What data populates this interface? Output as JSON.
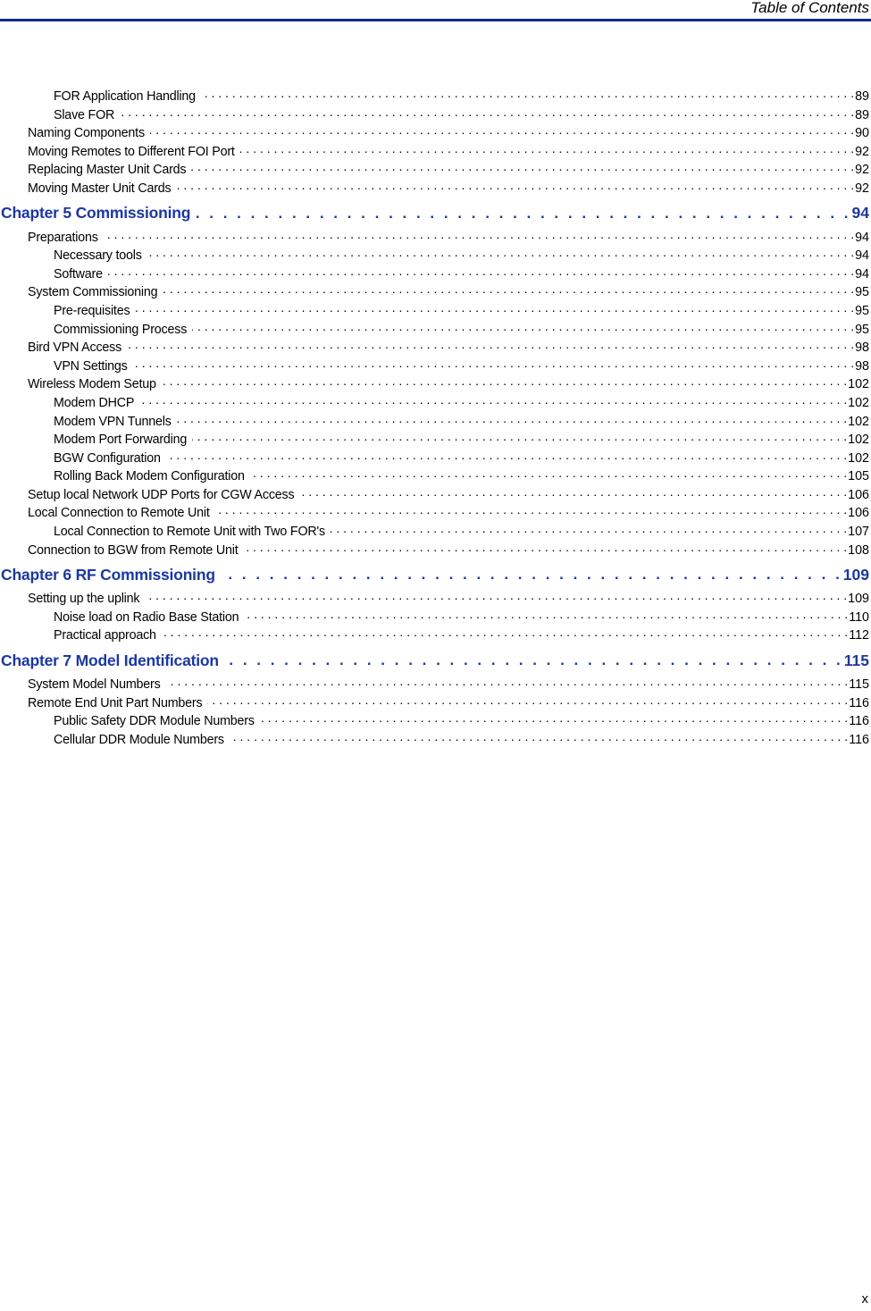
{
  "header": {
    "title": "Table of Contents",
    "rule_color": "#0a2a8f"
  },
  "toc": {
    "entries": [
      {
        "level": 2,
        "label": "FOR Application Handling",
        "page": "89"
      },
      {
        "level": 2,
        "label": "Slave FOR",
        "page": "89"
      },
      {
        "level": 1,
        "label": "Naming Components",
        "page": "90"
      },
      {
        "level": 1,
        "label": "Moving Remotes to Different FOI Port",
        "page": "92"
      },
      {
        "level": 1,
        "label": "Replacing Master Unit Cards",
        "page": "92"
      },
      {
        "level": 1,
        "label": "Moving Master Unit Cards",
        "page": "92"
      },
      {
        "level": 0,
        "label": "Chapter 5  Commissioning",
        "page": "94"
      },
      {
        "level": 1,
        "label": "Preparations",
        "page": "94"
      },
      {
        "level": 2,
        "label": "Necessary tools",
        "page": "94"
      },
      {
        "level": 2,
        "label": "Software",
        "page": "94"
      },
      {
        "level": 1,
        "label": "System Commissioning",
        "page": "95"
      },
      {
        "level": 2,
        "label": "Pre-requisites",
        "page": "95"
      },
      {
        "level": 2,
        "label": "Commissioning Process",
        "page": "95"
      },
      {
        "level": 1,
        "label": "Bird VPN Access",
        "page": "98"
      },
      {
        "level": 2,
        "label": "VPN Settings",
        "page": "98"
      },
      {
        "level": 1,
        "label": "Wireless Modem Setup",
        "page": "102"
      },
      {
        "level": 2,
        "label": "Modem DHCP",
        "page": "102"
      },
      {
        "level": 2,
        "label": "Modem VPN Tunnels",
        "page": "102"
      },
      {
        "level": 2,
        "label": "Modem Port Forwarding",
        "page": "102"
      },
      {
        "level": 2,
        "label": "BGW Configuration",
        "page": "102"
      },
      {
        "level": 2,
        "label": "Rolling Back Modem Configuration",
        "page": "105"
      },
      {
        "level": 1,
        "label": "Setup local Network UDP Ports for CGW Access",
        "page": "106"
      },
      {
        "level": 1,
        "label": "Local Connection to Remote Unit",
        "page": "106"
      },
      {
        "level": 2,
        "label": "Local Connection to Remote Unit with Two FOR's",
        "page": "107"
      },
      {
        "level": 1,
        "label": "Connection to BGW from Remote Unit",
        "page": "108"
      },
      {
        "level": 0,
        "label": "Chapter 6  RF Commissioning",
        "page": "109"
      },
      {
        "level": 1,
        "label": "Setting up the uplink",
        "page": "109"
      },
      {
        "level": 2,
        "label": "Noise load on Radio Base Station",
        "page": "110"
      },
      {
        "level": 2,
        "label": "Practical approach",
        "page": "112"
      },
      {
        "level": 0,
        "label": "Chapter 7  Model Identification",
        "page": "115"
      },
      {
        "level": 1,
        "label": "System Model Numbers",
        "page": "115"
      },
      {
        "level": 1,
        "label": "Remote End Unit Part Numbers",
        "page": "116"
      },
      {
        "level": 2,
        "label": "Public Safety DDR Module Numbers",
        "page": "116"
      },
      {
        "level": 2,
        "label": "Cellular DDR Module Numbers",
        "page": "116"
      }
    ]
  },
  "footer": {
    "page_number": "x"
  },
  "colors": {
    "chapter_heading": "#1c37a0",
    "text": "#000000"
  }
}
